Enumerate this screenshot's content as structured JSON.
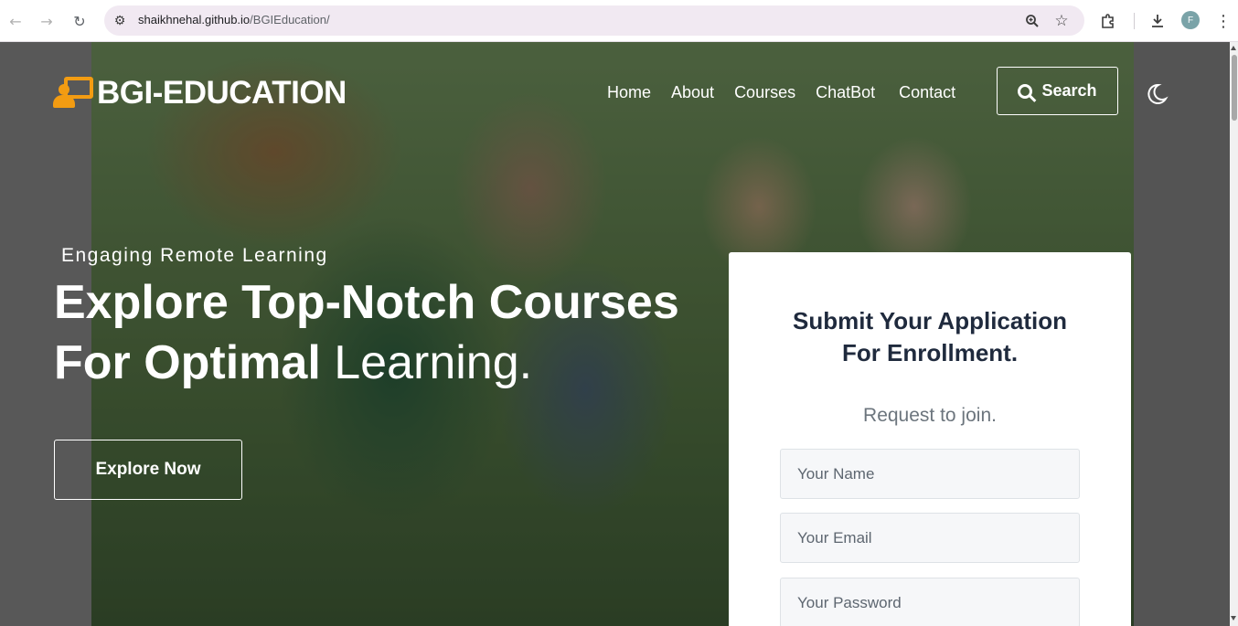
{
  "browser": {
    "url_host": "shaikhnehal.github.io",
    "url_path": "/BGIEducation/",
    "profile_initial": "F",
    "icons": [
      "back-arrow-icon",
      "forward-arrow-icon",
      "reload-icon",
      "site-settings-icon",
      "zoom-icon",
      "bookmark-star-icon",
      "extensions-icon",
      "download-icon",
      "menu-kebab-icon"
    ]
  },
  "header": {
    "logo_text": "BGI-EDUCATION",
    "nav": [
      "Home",
      "About",
      "Courses",
      "ChatBot",
      "Contact"
    ],
    "search_label": "Search"
  },
  "hero": {
    "kicker": "Engaging Remote Learning",
    "headline_line1": "Explore Top-Notch Courses",
    "headline_line2_bold": "For Optimal",
    "headline_line2_light": "Learning.",
    "cta_label": "Explore Now"
  },
  "form": {
    "title_line1": "Submit Your Application",
    "title_line2": "For Enrollment.",
    "subtitle": "Request to join.",
    "name_placeholder": "Your Name",
    "email_placeholder": "Your Email",
    "password_placeholder": "Your Password"
  },
  "colors": {
    "accent": "#f39c12",
    "form_title": "#1f2a3d",
    "omnibox": "#f1e9f2"
  }
}
